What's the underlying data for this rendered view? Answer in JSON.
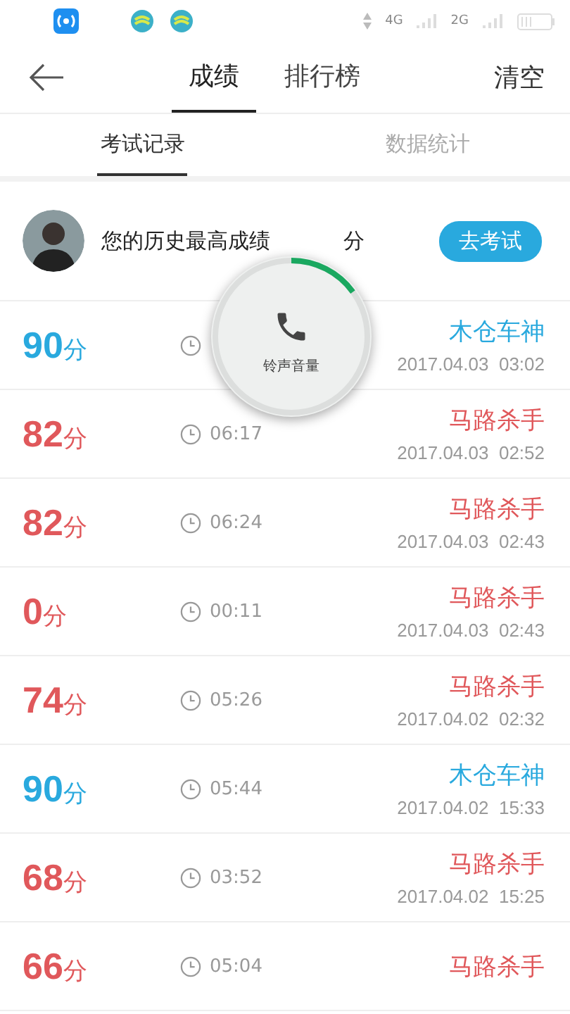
{
  "status_bar": {
    "network_1": "4G",
    "network_2": "2G"
  },
  "nav": {
    "tabs": [
      {
        "label": "成绩",
        "selected": true
      },
      {
        "label": "排行榜",
        "selected": false
      }
    ],
    "action": "清空"
  },
  "subtabs": [
    {
      "label": "考试记录",
      "selected": true
    },
    {
      "label": "数据统计",
      "selected": false
    }
  ],
  "summary": {
    "text_before": "您的历史最高成绩",
    "text_after": "分",
    "button": "去考试"
  },
  "records": [
    {
      "score": "90",
      "unit": "分",
      "color": "#29a9de",
      "name": "木仓车神",
      "datetime": "2017.04.03  03:02"
    },
    {
      "score": "82",
      "unit": "分",
      "color": "#e0585b",
      "duration": "06:17",
      "name": "马路杀手",
      "datetime": "2017.04.03  02:52"
    },
    {
      "score": "82",
      "unit": "分",
      "color": "#e0585b",
      "duration": "06:24",
      "name": "马路杀手",
      "datetime": "2017.04.03  02:43"
    },
    {
      "score": "0",
      "unit": "分",
      "color": "#e0585b",
      "duration": "00:11",
      "name": "马路杀手",
      "datetime": "2017.04.03  02:43"
    },
    {
      "score": "74",
      "unit": "分",
      "color": "#e0585b",
      "duration": "05:26",
      "name": "马路杀手",
      "datetime": "2017.04.02  02:32"
    },
    {
      "score": "90",
      "unit": "分",
      "color": "#29a9de",
      "duration": "05:44",
      "name": "木仓车神",
      "datetime": "2017.04.02  15:33"
    },
    {
      "score": "68",
      "unit": "分",
      "color": "#e0585b",
      "duration": "03:52",
      "name": "马路杀手",
      "datetime": "2017.04.02  15:25"
    },
    {
      "score": "66",
      "unit": "分",
      "color": "#e0585b",
      "duration": "05:04",
      "name": "马路杀手"
    }
  ],
  "volume_toast": {
    "label": "铃声音量",
    "level": 0.15
  }
}
